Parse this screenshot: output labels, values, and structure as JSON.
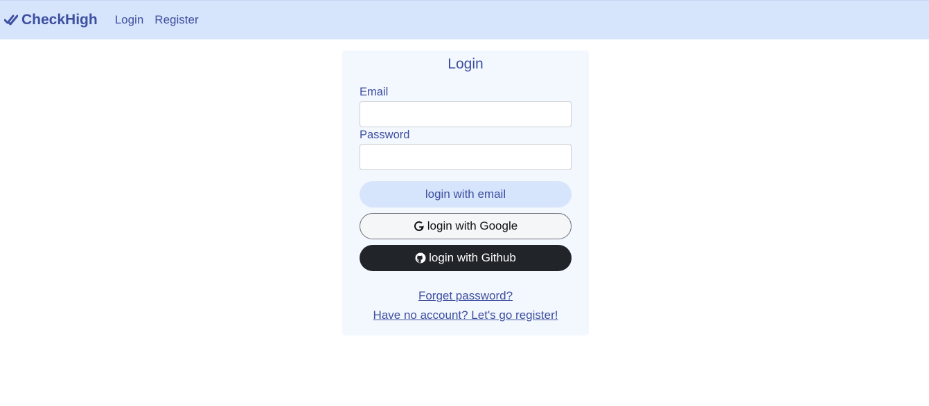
{
  "navbar": {
    "brand": "CheckHigh",
    "brand_icon": "double-check-icon",
    "links": [
      "Login",
      "Register"
    ]
  },
  "login_card": {
    "title": "Login",
    "email_label": "Email",
    "email_value": "",
    "password_label": "Password",
    "password_value": "",
    "email_button": "login with email",
    "google_button": "login with Google",
    "google_icon": "google-icon",
    "github_button": "login with Github",
    "github_icon": "github-icon",
    "forget_link": "Forget password?",
    "register_link": "Have no account? Let's go register!"
  },
  "colors": {
    "accent": "#3d4fa0",
    "navbar_bg": "#d6e4fc",
    "card_bg": "#f3f7fe",
    "github_button_bg": "#212529"
  }
}
